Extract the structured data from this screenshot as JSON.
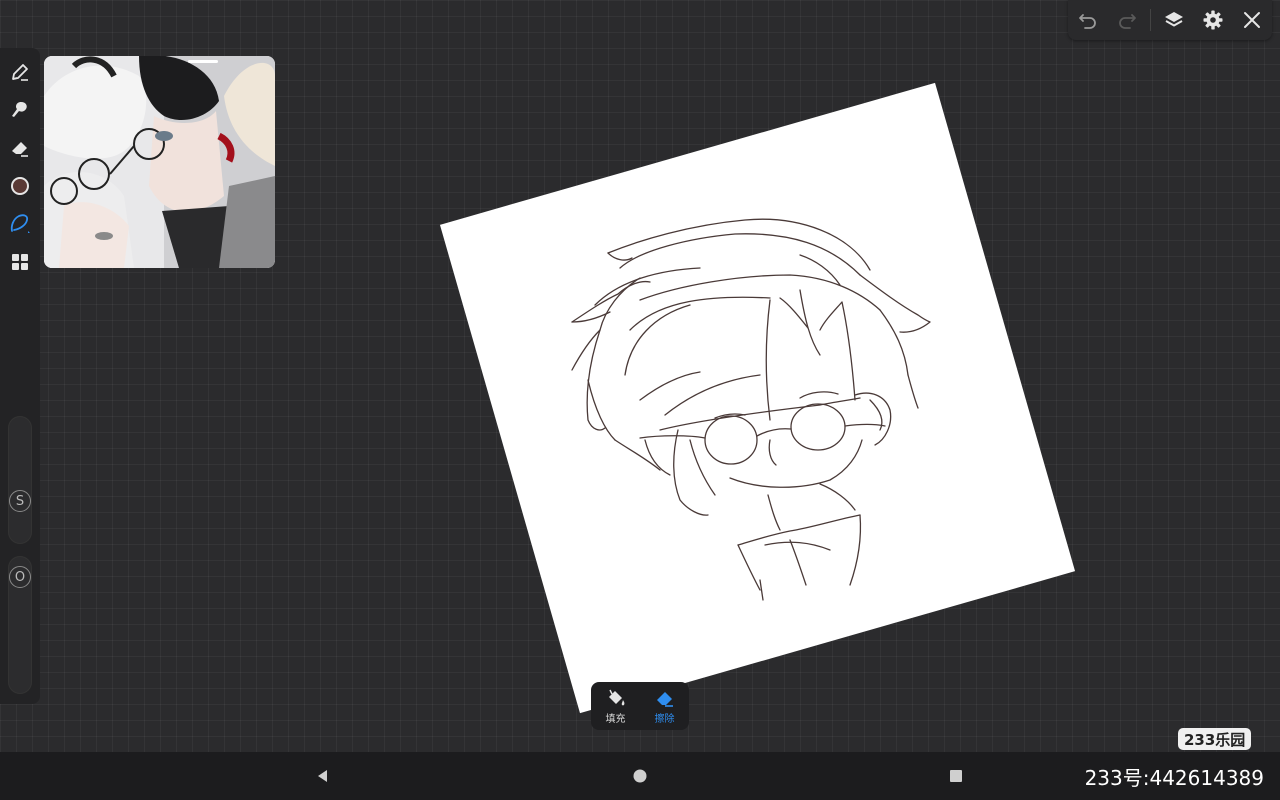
{
  "top_bar": {
    "icons": [
      "undo-icon",
      "redo-icon",
      "layers-icon",
      "gear-icon",
      "close-icon"
    ]
  },
  "left_toolbar": {
    "tools": [
      "brush-icon",
      "smudge-icon",
      "eraser-icon",
      "color-swatch",
      "lasso-icon",
      "grid-icon"
    ],
    "current_color": "#5a3a36",
    "size_slider_label": "S",
    "opacity_slider_label": "O"
  },
  "reference_window": {
    "image": "anime-characters-reference"
  },
  "popup": {
    "fill_label": "填充",
    "erase_label": "擦除",
    "active_color": "#2f8ef0"
  },
  "watermark": {
    "logo_text": "233乐园",
    "id_text": "233号:442614389"
  },
  "colors": {
    "background": "#2b2b2d",
    "panel": "#232325",
    "accent": "#2f8ef0",
    "sketch_line": "#4a3a38"
  }
}
